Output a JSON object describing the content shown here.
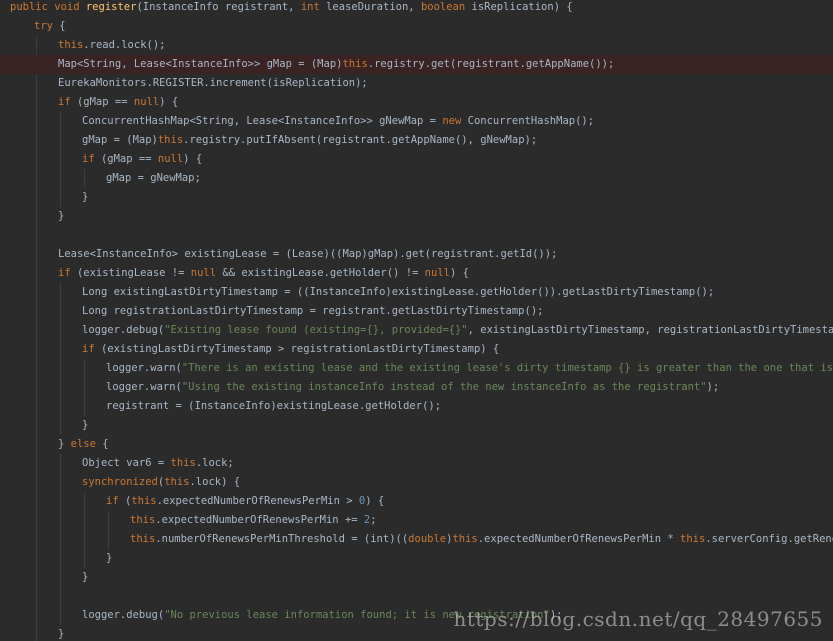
{
  "editor": {
    "background": "#2b2b2b",
    "highlight_color": "#3a2323",
    "colors": {
      "keyword": "#cc7832",
      "identifier": "#a9b7c6",
      "method_declaration": "#ffc66d",
      "string": "#6a8759",
      "number": "#6897bb",
      "field": "#9876aa"
    },
    "lines": [
      {
        "indent": 0,
        "tokens": [
          [
            "kw",
            "public void "
          ],
          [
            "fn",
            "register"
          ],
          [
            "id",
            "(InstanceInfo registrant, "
          ],
          [
            "kw",
            "int "
          ],
          [
            "id",
            "leaseDuration, "
          ],
          [
            "kw",
            "boolean "
          ],
          [
            "id",
            "isReplication) {"
          ]
        ]
      },
      {
        "indent": 1,
        "tokens": [
          [
            "kw",
            "try "
          ],
          [
            "id",
            "{"
          ]
        ]
      },
      {
        "indent": 2,
        "tokens": [
          [
            "kw",
            "this"
          ],
          [
            "id",
            ".read.lock();"
          ]
        ]
      },
      {
        "indent": 2,
        "highlight": true,
        "tokens": [
          [
            "id",
            "Map<String, Lease<InstanceInfo>> gMap = (Map)"
          ],
          [
            "kw",
            "this"
          ],
          [
            "id",
            ".registry.get(registrant.getAppName());"
          ]
        ]
      },
      {
        "indent": 2,
        "tokens": [
          [
            "id",
            "EurekaMonitors.REGISTER.increment(isReplication);"
          ]
        ]
      },
      {
        "indent": 2,
        "tokens": [
          [
            "kw",
            "if "
          ],
          [
            "id",
            "(gMap == "
          ],
          [
            "kw",
            "null"
          ],
          [
            "id",
            ") {"
          ]
        ]
      },
      {
        "indent": 3,
        "tokens": [
          [
            "id",
            "ConcurrentHashMap<String, Lease<InstanceInfo>> gNewMap = "
          ],
          [
            "kw",
            "new "
          ],
          [
            "id",
            "ConcurrentHashMap();"
          ]
        ]
      },
      {
        "indent": 3,
        "tokens": [
          [
            "id",
            "gMap = (Map)"
          ],
          [
            "kw",
            "this"
          ],
          [
            "id",
            ".registry.putIfAbsent(registrant.getAppName(), gNewMap);"
          ]
        ]
      },
      {
        "indent": 3,
        "tokens": [
          [
            "kw",
            "if "
          ],
          [
            "id",
            "(gMap == "
          ],
          [
            "kw",
            "null"
          ],
          [
            "id",
            ") {"
          ]
        ]
      },
      {
        "indent": 4,
        "tokens": [
          [
            "id",
            "gMap = gNewMap;"
          ]
        ]
      },
      {
        "indent": 3,
        "tokens": [
          [
            "id",
            "}"
          ]
        ]
      },
      {
        "indent": 2,
        "tokens": [
          [
            "id",
            "}"
          ]
        ]
      },
      {
        "indent": 0,
        "tokens": []
      },
      {
        "indent": 2,
        "tokens": [
          [
            "id",
            "Lease<InstanceInfo> existingLease = (Lease)((Map)gMap).get(registrant.getId());"
          ]
        ]
      },
      {
        "indent": 2,
        "tokens": [
          [
            "kw",
            "if "
          ],
          [
            "id",
            "(existingLease != "
          ],
          [
            "kw",
            "null "
          ],
          [
            "id",
            "&& existingLease.getHolder() != "
          ],
          [
            "kw",
            "null"
          ],
          [
            "id",
            ") {"
          ]
        ]
      },
      {
        "indent": 3,
        "tokens": [
          [
            "id",
            "Long existingLastDirtyTimestamp = ((InstanceInfo)existingLease.getHolder()).getLastDirtyTimestamp();"
          ]
        ]
      },
      {
        "indent": 3,
        "tokens": [
          [
            "id",
            "Long registrationLastDirtyTimestamp = registrant.getLastDirtyTimestamp();"
          ]
        ]
      },
      {
        "indent": 3,
        "tokens": [
          [
            "id",
            "logger.debug("
          ],
          [
            "str",
            "\"Existing lease found (existing={}, provided={}\""
          ],
          [
            "id",
            ", existingLastDirtyTimestamp, registrationLastDirtyTimestamp);"
          ]
        ]
      },
      {
        "indent": 3,
        "tokens": [
          [
            "kw",
            "if "
          ],
          [
            "id",
            "(existingLastDirtyTimestamp > registrationLastDirtyTimestamp) {"
          ]
        ]
      },
      {
        "indent": 4,
        "tokens": [
          [
            "id",
            "logger.warn("
          ],
          [
            "str",
            "\"There is an existing lease and the existing lease's dirty timestamp {} is greater than the one that is being"
          ]
        ]
      },
      {
        "indent": 4,
        "tokens": [
          [
            "id",
            "logger.warn("
          ],
          [
            "str",
            "\"Using the existing instanceInfo instead of the new instanceInfo as the registrant\""
          ],
          [
            "id",
            ");"
          ]
        ]
      },
      {
        "indent": 4,
        "tokens": [
          [
            "id",
            "registrant = (InstanceInfo)existingLease.getHolder();"
          ]
        ]
      },
      {
        "indent": 3,
        "tokens": [
          [
            "id",
            "}"
          ]
        ]
      },
      {
        "indent": 2,
        "tokens": [
          [
            "id",
            "} "
          ],
          [
            "kw",
            "else "
          ],
          [
            "id",
            "{"
          ]
        ]
      },
      {
        "indent": 3,
        "tokens": [
          [
            "id",
            "Object var6 = "
          ],
          [
            "kw",
            "this"
          ],
          [
            "id",
            ".lock;"
          ]
        ]
      },
      {
        "indent": 3,
        "tokens": [
          [
            "kw",
            "synchronized"
          ],
          [
            "id",
            "("
          ],
          [
            "kw",
            "this"
          ],
          [
            "id",
            ".lock) {"
          ]
        ]
      },
      {
        "indent": 4,
        "tokens": [
          [
            "kw",
            "if "
          ],
          [
            "id",
            "("
          ],
          [
            "kw",
            "this"
          ],
          [
            "id",
            ".expectedNumberOfRenewsPerMin > "
          ],
          [
            "num",
            "0"
          ],
          [
            "id",
            ") {"
          ]
        ]
      },
      {
        "indent": 5,
        "tokens": [
          [
            "kw",
            "this"
          ],
          [
            "id",
            ".expectedNumberOfRenewsPerMin += "
          ],
          [
            "num",
            "2"
          ],
          [
            "id",
            ";"
          ]
        ]
      },
      {
        "indent": 5,
        "tokens": [
          [
            "kw",
            "this"
          ],
          [
            "id",
            ".numberOfRenewsPerMinThreshold = (int)(("
          ],
          [
            "kw",
            "double"
          ],
          [
            "id",
            ")"
          ],
          [
            "kw",
            "this"
          ],
          [
            "id",
            ".expectedNumberOfRenewsPerMin * "
          ],
          [
            "kw",
            "this"
          ],
          [
            "id",
            ".serverConfig.getRenewalPe"
          ]
        ]
      },
      {
        "indent": 4,
        "tokens": [
          [
            "id",
            "}"
          ]
        ]
      },
      {
        "indent": 3,
        "tokens": [
          [
            "id",
            "}"
          ]
        ]
      },
      {
        "indent": 0,
        "tokens": []
      },
      {
        "indent": 3,
        "tokens": [
          [
            "id",
            "logger.debug("
          ],
          [
            "str",
            "\"No previous lease information found; it is new registration\""
          ],
          [
            "id",
            ");"
          ]
        ]
      },
      {
        "indent": 2,
        "tokens": [
          [
            "id",
            "}"
          ]
        ]
      }
    ]
  },
  "watermark": "https://blog.csdn.net/qq_28497655"
}
